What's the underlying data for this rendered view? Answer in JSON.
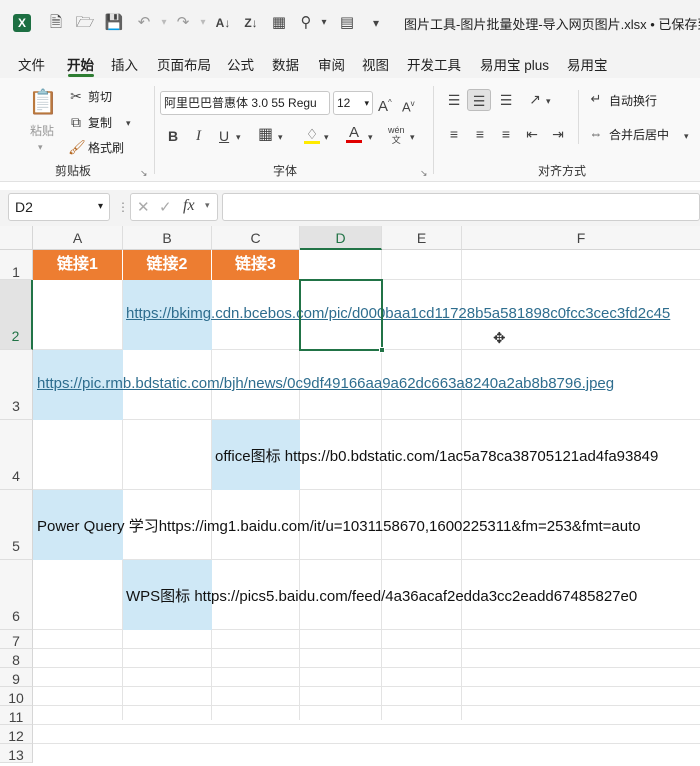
{
  "title_bar": {
    "doc_title": "图片工具-图片批量处理-导入网页图片.xlsx • 已保存到这"
  },
  "tabs": [
    "文件",
    "开始",
    "插入",
    "页面布局",
    "公式",
    "数据",
    "审阅",
    "视图",
    "开发工具",
    "易用宝 plus",
    "易用宝"
  ],
  "active_tab": "开始",
  "ribbon": {
    "clipboard": {
      "paste": "粘贴",
      "cut": "剪切",
      "copy": "复制",
      "format_painter": "格式刷",
      "group": "剪贴板"
    },
    "font": {
      "font_name": "阿里巴巴普惠体 3.0 55 Regu",
      "font_size": "12",
      "bold": "B",
      "italic": "I",
      "underline": "U",
      "group": "字体"
    },
    "alignment": {
      "wrap": "自动换行",
      "merge": "合并后居中",
      "group": "对齐方式"
    }
  },
  "formula_bar": {
    "name_box": "D2",
    "fx": "fx",
    "value": ""
  },
  "sheet": {
    "columns": [
      "A",
      "B",
      "C",
      "D",
      "E",
      "F"
    ],
    "rows": [
      "1",
      "2",
      "3",
      "4",
      "5",
      "6",
      "7",
      "8",
      "9",
      "10",
      "11",
      "12",
      "13"
    ],
    "headers": [
      "链接1",
      "链接2",
      "链接3"
    ],
    "selected_cell": "D2",
    "cells": {
      "r2": "https://bkimg.cdn.bcebos.com/pic/d000baa1cd11728b5a581898c0fcc3cec3fd2c45",
      "r3": "https://pic.rmb.bdstatic.com/bjh/news/0c9df49166aa9a62dc663a8240a2ab8b8796.jpeg",
      "r4": "office图标 https://b0.bdstatic.com/1ac5a78ca38705121ad4fa93849",
      "r5": "Power Query 学习https://img1.baidu.com/it/u=1031158670,1600225311&fm=253&fmt=auto",
      "r6": "WPS图标 https://pics5.baidu.com/feed/4a36acaf2edda3cc2eadd67485827e0"
    }
  },
  "colors": {
    "header_orange": "#ed7d31",
    "fill_blue": "#cfe8f6",
    "accent_green": "#217346"
  }
}
